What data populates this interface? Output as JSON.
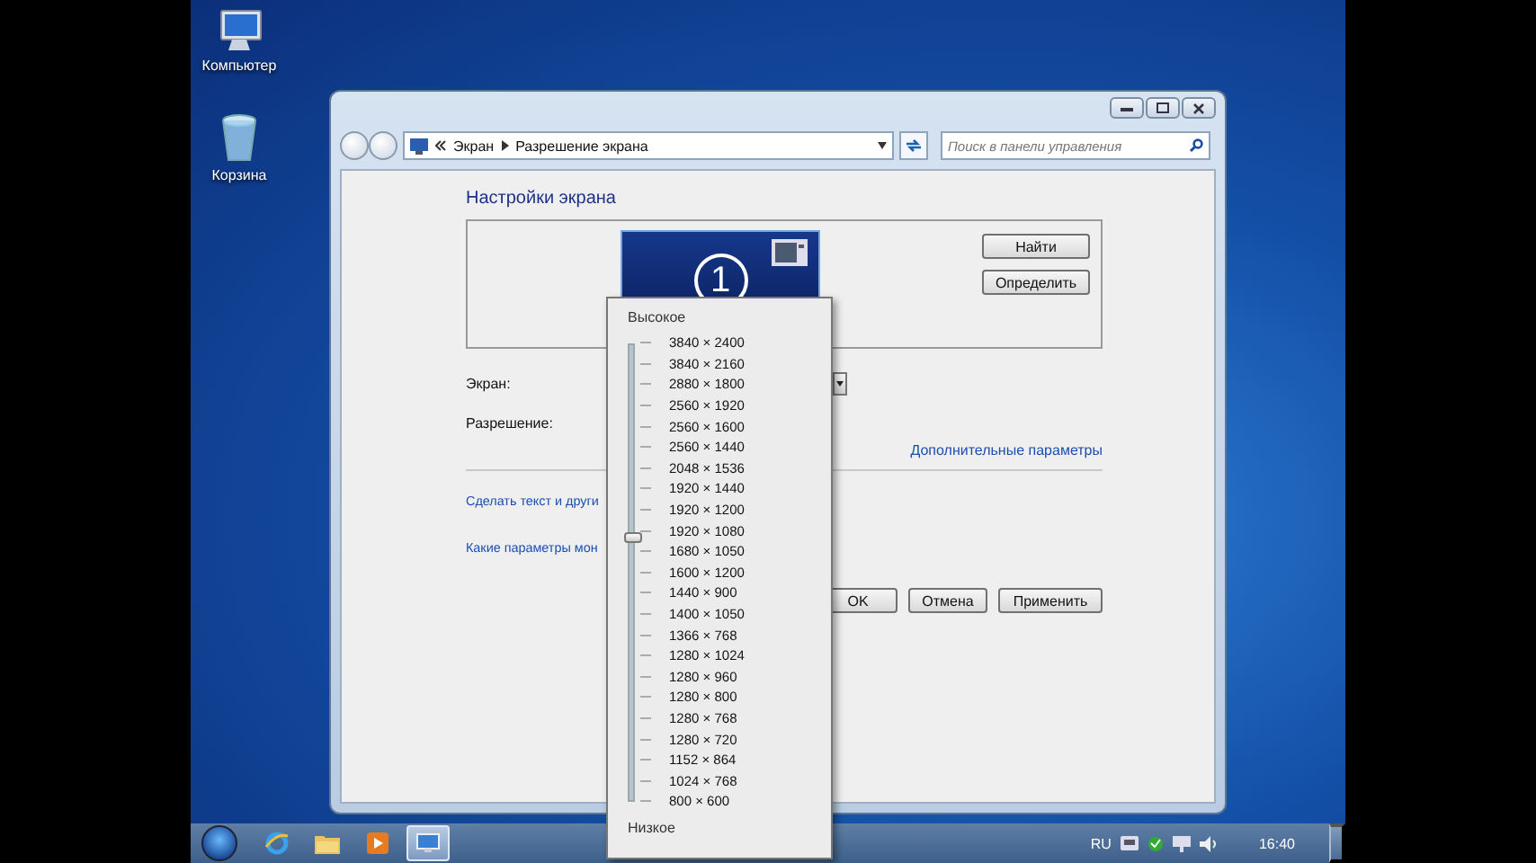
{
  "desktop_icons": [
    {
      "label": "Компьютер",
      "kind": "computer"
    },
    {
      "label": "Корзина",
      "kind": "bin"
    }
  ],
  "window": {
    "breadcrumb": [
      "Экран",
      "Разрешение экрана"
    ],
    "search": {
      "placeholder": "Поиск в панели управления"
    },
    "heading": "Настройки экрана",
    "monitor_number": "1",
    "side_buttons": [
      "Найти",
      "Определить"
    ],
    "fields": [
      "Экран:",
      "Разрешение:"
    ],
    "advanced_link": "Дополнительные параметры",
    "links": [
      "Сделать текст и други",
      "Какие параметры мон"
    ],
    "buttons": [
      "OK",
      "Отмена",
      "Применить"
    ]
  },
  "resolution_popup": {
    "high_label": "Высокое",
    "low_label": "Низкое",
    "level": 0.59,
    "options": [
      "3840 × 2400",
      "3840 × 2160",
      "2880 × 1800",
      "2560 × 1920",
      "2560 × 1600",
      "2560 × 1440",
      "2048 × 1536",
      "1920 × 1440",
      "1920 × 1200",
      "1920 × 1080",
      "1680 × 1050",
      "1600 × 1200",
      "1440 × 900",
      "1400 × 1050",
      "1366 × 768",
      "1280 × 1024",
      "1280 × 960",
      "1280 × 800",
      "1280 × 768",
      "1280 × 720",
      "1152 × 864",
      "1024 × 768",
      "800 × 600"
    ]
  },
  "taskbar": {
    "apps": [
      {
        "kind": "browser",
        "selected": false
      },
      {
        "kind": "folder",
        "selected": false
      },
      {
        "kind": "player",
        "selected": false
      },
      {
        "kind": "display",
        "selected": true
      }
    ],
    "language": "RU",
    "clock": "16:40"
  }
}
